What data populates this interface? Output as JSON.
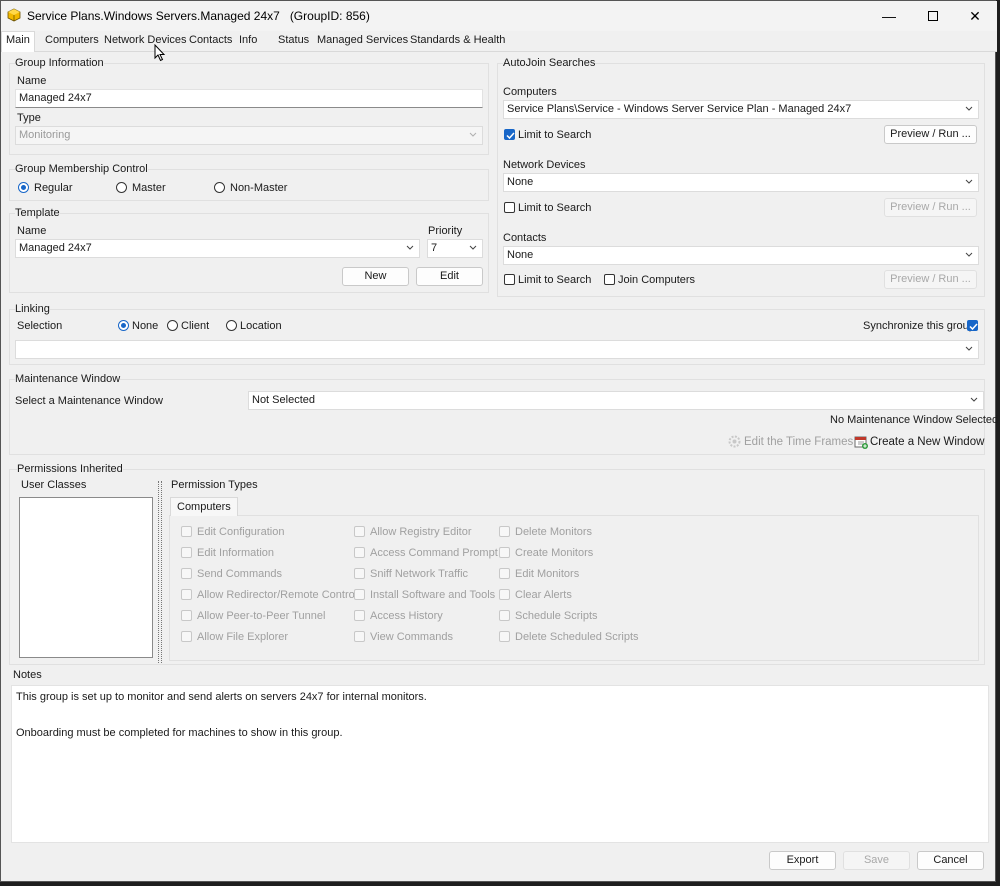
{
  "window": {
    "title": "Service Plans.Windows Servers.Managed 24x7",
    "group_id": "(GroupID: 856)"
  },
  "tabs": [
    "Main",
    "Computers",
    "Network Devices",
    "Contacts",
    "Info",
    "Status",
    "Managed Services",
    "Standards & Health"
  ],
  "group_information": {
    "label": "Group Information",
    "name_label": "Name",
    "name_value": "Managed 24x7",
    "type_label": "Type",
    "type_value": "Monitoring"
  },
  "membership": {
    "label": "Group Membership Control",
    "options": [
      "Regular",
      "Master",
      "Non-Master"
    ],
    "selected": "Regular"
  },
  "template": {
    "label": "Template",
    "name_label": "Name",
    "name_value": "Managed 24x7",
    "priority_label": "Priority",
    "priority_value": "7",
    "new_label": "New",
    "edit_label": "Edit"
  },
  "autojoin": {
    "label": "AutoJoin Searches",
    "computers_label": "Computers",
    "computers_value": "Service Plans\\Service - Windows Server Service Plan - Managed 24x7",
    "computers_limit": "Limit to Search",
    "computers_limit_checked": true,
    "preview_label": "Preview / Run ...",
    "network_label": "Network Devices",
    "network_value": "None",
    "network_limit": "Limit to Search",
    "contacts_label": "Contacts",
    "contacts_value": "None",
    "contacts_limit": "Limit to Search",
    "join_computers": "Join Computers"
  },
  "linking": {
    "label": "Linking",
    "selection_label": "Selection",
    "options": [
      "None",
      "Client",
      "Location"
    ],
    "selected": "None",
    "sync_label": "Synchronize this group",
    "sync_checked": true
  },
  "maintenance": {
    "label": "Maintenance Window",
    "select_label": "Select a Maintenance Window",
    "value": "Not Selected",
    "status": "No Maintenance Window Selected",
    "edit_time_frames": "Edit the Time Frames",
    "create_window": "Create a New Window"
  },
  "permissions": {
    "label": "Permissions Inherited",
    "user_classes_label": "User Classes",
    "types_label": "Permission Types",
    "types_tab": "Computers",
    "col1": [
      "Edit Configuration",
      "Edit Information",
      "Send Commands",
      "Allow Redirector/Remote Control",
      "Allow Peer-to-Peer Tunnel",
      "Allow File Explorer"
    ],
    "col2": [
      "Allow Registry Editor",
      "Access Command Prompt",
      "Sniff Network Traffic",
      "Install Software and Tools",
      "Access History",
      "View Commands"
    ],
    "col3": [
      "Delete Monitors",
      "Create Monitors",
      "Edit Monitors",
      "Clear Alerts",
      "Schedule Scripts",
      "Delete Scheduled Scripts"
    ]
  },
  "notes": {
    "label": "Notes",
    "line1": "This group is set up to monitor and send alerts on servers 24x7 for internal monitors.",
    "line2": "Onboarding must be completed for machines to show in this group."
  },
  "footer": {
    "export_label": "Export",
    "save_label": "Save",
    "cancel_label": "Cancel"
  }
}
